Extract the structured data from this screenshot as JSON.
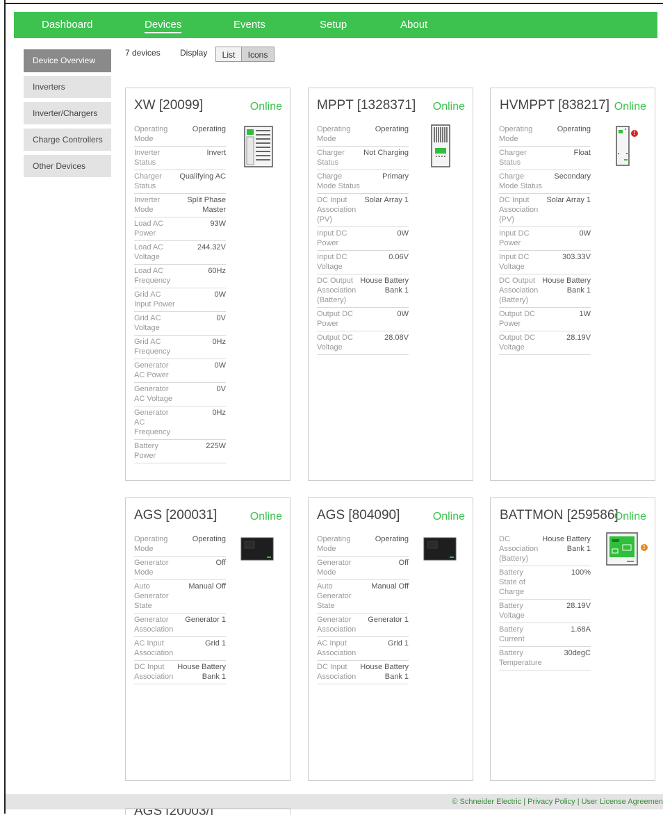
{
  "nav": {
    "items": [
      {
        "label": "Dashboard"
      },
      {
        "label": "Devices"
      },
      {
        "label": "Events"
      },
      {
        "label": "Setup"
      },
      {
        "label": "About"
      }
    ],
    "active": "Devices",
    "color": "#3dc24f"
  },
  "sidebar": {
    "items": [
      {
        "label": "Device Overview"
      },
      {
        "label": "Inverters"
      },
      {
        "label": "Inverter/Chargers"
      },
      {
        "label": "Charge Controllers"
      },
      {
        "label": "Other Devices"
      }
    ],
    "active": "Device Overview"
  },
  "toolbar": {
    "device_count": "7 devices",
    "display_label": "Display",
    "list_label": "List",
    "icons_label": "Icons"
  },
  "cards": [
    {
      "title": "XW [20099]",
      "status": "Online",
      "icon": "inverter-charger-icon",
      "rows": [
        {
          "label": "Operating Mode",
          "value": "Operating"
        },
        {
          "label": "Inverter Status",
          "value": "Invert"
        },
        {
          "label": "Charger Status",
          "value": "Qualifying AC"
        },
        {
          "label": "Inverter Mode",
          "value": "Split Phase Master"
        },
        {
          "label": "Load AC Power",
          "value": "93W"
        },
        {
          "label": "Load AC Voltage",
          "value": "244.32V"
        },
        {
          "label": "Load AC Frequency",
          "value": "60Hz"
        },
        {
          "label": "Grid AC Input Power",
          "value": "0W"
        },
        {
          "label": "Grid AC Voltage",
          "value": "0V"
        },
        {
          "label": "Grid AC Frequency",
          "value": "0Hz"
        },
        {
          "label": "Generator AC Power",
          "value": "0W"
        },
        {
          "label": "Generator AC Voltage",
          "value": "0V"
        },
        {
          "label": "Generator AC Frequency",
          "value": "0Hz"
        },
        {
          "label": "Battery Power",
          "value": "225W"
        }
      ]
    },
    {
      "title": "MPPT [1328371]",
      "status": "Online",
      "icon": "charge-controller-icon",
      "rows": [
        {
          "label": "Operating Mode",
          "value": "Operating"
        },
        {
          "label": "Charger Status",
          "value": "Not Charging"
        },
        {
          "label": "Charge Mode Status",
          "value": "Primary"
        },
        {
          "label": "DC Input Association (PV)",
          "value": "Solar Array 1"
        },
        {
          "label": "Input DC Power",
          "value": "0W"
        },
        {
          "label": "Input DC Voltage",
          "value": "0.06V"
        },
        {
          "label": "DC Output Association (Battery)",
          "value": "House Battery Bank 1"
        },
        {
          "label": "Output DC Power",
          "value": "0W"
        },
        {
          "label": "Output DC Voltage",
          "value": "28.08V"
        }
      ]
    },
    {
      "title": "HVMPPT [838217]",
      "status": "Online",
      "icon": "hv-charge-controller-icon",
      "alert_color": "#e02020",
      "rows": [
        {
          "label": "Operating Mode",
          "value": "Operating"
        },
        {
          "label": "Charger Status",
          "value": "Float"
        },
        {
          "label": "Charge Mode Status",
          "value": "Secondary"
        },
        {
          "label": "DC Input Association (PV)",
          "value": "Solar Array 1"
        },
        {
          "label": "Input DC Power",
          "value": "0W"
        },
        {
          "label": "Input DC Voltage",
          "value": "303.33V"
        },
        {
          "label": "DC Output Association (Battery)",
          "value": "House Battery Bank 1"
        },
        {
          "label": "Output DC Power",
          "value": "1W"
        },
        {
          "label": "Output DC Voltage",
          "value": "28.19V"
        }
      ]
    },
    {
      "title": "AGS [200031]",
      "status": "Online",
      "icon": "ags-icon",
      "rows": [
        {
          "label": "Operating Mode",
          "value": "Operating"
        },
        {
          "label": "Generator Mode",
          "value": "Off"
        },
        {
          "label": "Auto Generator State",
          "value": "Manual Off"
        },
        {
          "label": "Generator Association",
          "value": "Generator 1"
        },
        {
          "label": "AC Input Association",
          "value": "Grid 1"
        },
        {
          "label": "DC Input Association",
          "value": "House Battery Bank 1"
        }
      ]
    },
    {
      "title": "AGS [804090]",
      "status": "Online",
      "icon": "ags-icon",
      "rows": [
        {
          "label": "Operating Mode",
          "value": "Operating"
        },
        {
          "label": "Generator Mode",
          "value": "Off"
        },
        {
          "label": "Auto Generator State",
          "value": "Manual Off"
        },
        {
          "label": "Generator Association",
          "value": "Generator 1"
        },
        {
          "label": "AC Input Association",
          "value": "Grid 1"
        },
        {
          "label": "DC Input Association",
          "value": "House Battery Bank 1"
        }
      ]
    },
    {
      "title": "BATTMON [259586]",
      "status": "Online",
      "icon": "battery-monitor-icon",
      "alert_color": "#e8891a",
      "rows": [
        {
          "label": "DC Association (Battery)",
          "value": "House Battery Bank 1"
        },
        {
          "label": "Battery State of Charge",
          "value": "100%"
        },
        {
          "label": "Battery Voltage",
          "value": "28.19V"
        },
        {
          "label": "Battery Current",
          "value": "1.68A"
        },
        {
          "label": "Battery Temperature",
          "value": "30degC"
        }
      ]
    }
  ],
  "footer": {
    "text": "© Schneider Electric | Privacy Policy | User License Agreemen"
  },
  "partial_card": {
    "title": "AGS [20003/]"
  }
}
